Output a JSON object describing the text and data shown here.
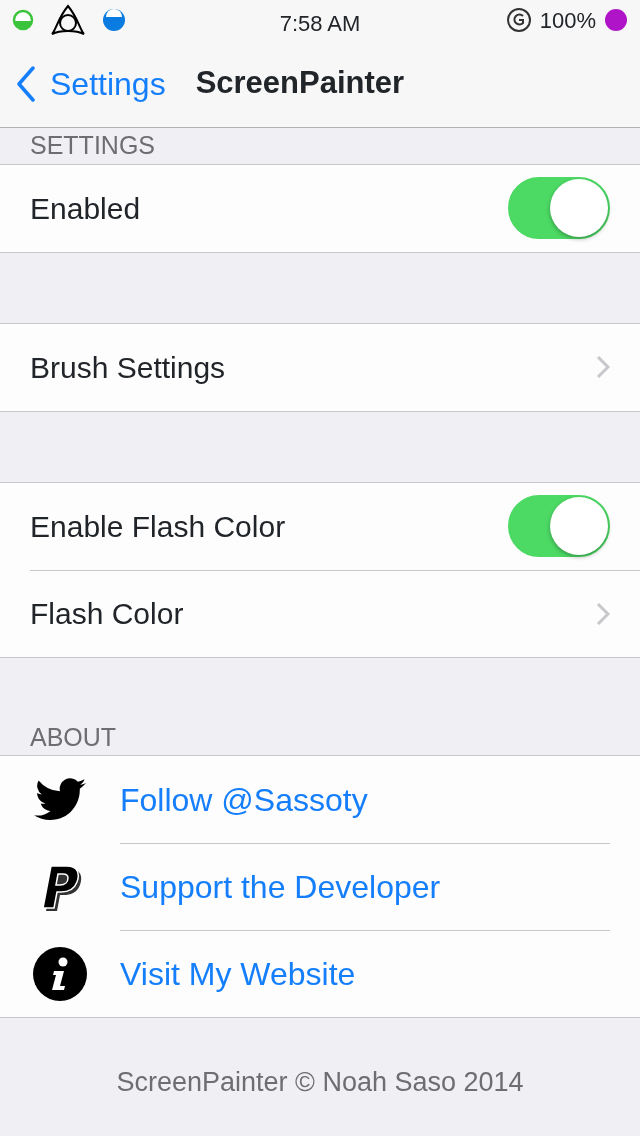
{
  "status_bar": {
    "time": "7:58 AM",
    "battery": "100%"
  },
  "nav_bar": {
    "back": "Settings",
    "title": "ScreenPainter"
  },
  "sections": [
    {
      "header": "SETTINGS",
      "rows": [
        {
          "kind": "toggle",
          "label": "Enabled",
          "on": true
        }
      ]
    },
    {
      "rows": [
        {
          "kind": "link",
          "label": "Brush Settings"
        }
      ]
    },
    {
      "rows": [
        {
          "kind": "toggle",
          "label": "Enable Flash Color",
          "on": true
        },
        {
          "kind": "link",
          "label": "Flash Color"
        }
      ]
    },
    {
      "header": "ABOUT",
      "rows": [
        {
          "kind": "action",
          "label": "Follow @Sassoty"
        },
        {
          "kind": "action",
          "label": "Support the Developer"
        },
        {
          "kind": "action",
          "label": "Visit My Website"
        }
      ]
    }
  ],
  "footer": "ScreenPainter © Noah Saso 2014"
}
